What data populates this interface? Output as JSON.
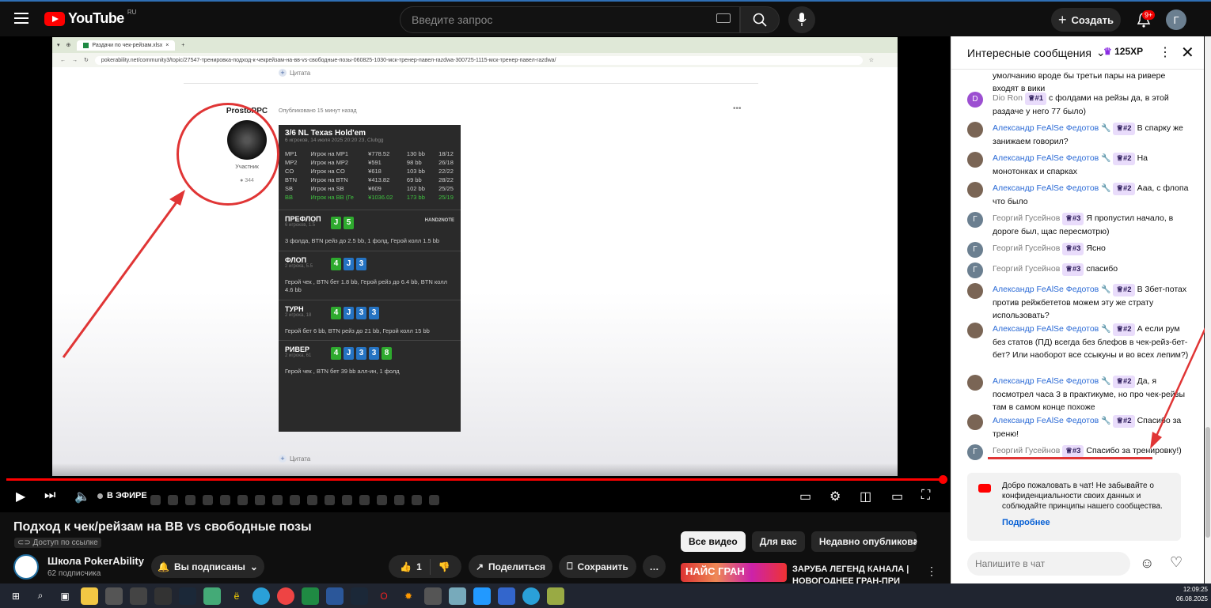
{
  "header": {
    "logo_text": "YouTube",
    "logo_region": "RU",
    "search_placeholder": "Введите запрос",
    "create_label": "Создать",
    "notif_count": "9+",
    "avatar_letter": "Г"
  },
  "video": {
    "browser_tab": "Раздачи по чек-рейзам.xlsx",
    "browser_url": "pokerability.net/community3/topic/27547-тренировка-подход-к-чекрейзам-на-вв-vs-свободные-позы-060825-1030-мск-тренер-павел-razdwa-300725-1115-мск-тренер-павел-razdwa/",
    "quote_label": "Цитата",
    "post_author": "ProstoPPC",
    "post_rank": "Участник",
    "post_count": "344",
    "post_time": "Опубликовано 15 минут назад",
    "hand": {
      "title": "3/6 NL Texas Hold'em",
      "subtitle": "6 игроков, 14 июля 2025 20:20 23, Clubgg",
      "players": [
        {
          "pos": "MP1",
          "name": "Игрок на MP1",
          "stack": "¥778.52",
          "bb": "130 bb",
          "stat": "18/12",
          "hero": false
        },
        {
          "pos": "MP2",
          "name": "Игрок на MP2",
          "stack": "¥591",
          "bb": "98 bb",
          "stat": "26/18",
          "hero": false
        },
        {
          "pos": "CO",
          "name": "Игрок на CO",
          "stack": "¥618",
          "bb": "103 bb",
          "stat": "22/22",
          "hero": false
        },
        {
          "pos": "BTN",
          "name": "Игрок на BTN",
          "stack": "¥413.82",
          "bb": "69 bb",
          "stat": "28/22",
          "hero": false
        },
        {
          "pos": "SB",
          "name": "Игрок на SB",
          "stack": "¥609",
          "bb": "102 bb",
          "stat": "25/25",
          "hero": false
        },
        {
          "pos": "BB",
          "name": "Игрок на BB (Ге",
          "stack": "¥1036.02",
          "bb": "173 bb",
          "stat": "25/19",
          "hero": true
        }
      ],
      "brand": "HAND2NOTE",
      "preflop": {
        "name": "ПРЕФЛОП",
        "count": "6 игроков, 1.5",
        "cards": [
          "J",
          "5"
        ],
        "action": "3 фолда, BTN рейз до 2.5 bb, 1 фолд, Герой колл 1.5 bb"
      },
      "flop": {
        "name": "ФЛОП",
        "count": "2 игрока, 5.5",
        "cards": [
          "4",
          "J",
          "3"
        ],
        "action": "Герой чек , BTN бет 1.8 bb, Герой рейз до 6.4 bb, BTN колл 4.6 bb"
      },
      "turn": {
        "name": "ТУРН",
        "count": "2 игрока, 18",
        "cards": [
          "4",
          "J",
          "3",
          "3"
        ],
        "action": "Герой бет 6 bb, BTN рейз до 21 bb, Герой колл 15 bb"
      },
      "river": {
        "name": "РИВЕР",
        "count": "2 игрока, 61",
        "cards": [
          "4",
          "J",
          "3",
          "3",
          "8"
        ],
        "action": "Герой чек , BTN бет 39 bb алл-ин, 1 фолд"
      }
    },
    "live_label": "В ЭФИРЕ",
    "progress": 1.0
  },
  "info": {
    "title": "Подход к чек/рейзам на BB vs свободные позы",
    "access": "Доступ по ссылке",
    "channel": "Школа PokerAbility",
    "subs": "62 подписчика",
    "subscribed": "Вы подписаны",
    "likes": "1",
    "share": "Поделиться",
    "save": "Сохранить"
  },
  "recs": {
    "chips": [
      "Все видео",
      "Для вас",
      "Недавно опубликованн"
    ],
    "thumb_text": "НАЙС ГРАН",
    "first_title": "ЗАРУБА ЛЕГЕНД КАНАЛА | НОВОГОДНЕЕ ГРАН-ПРИ"
  },
  "chat": {
    "header": "Интересные сообщения",
    "xp": "125XP",
    "messages": [
      {
        "author": "",
        "badge": "",
        "text": "умолчанию вроде бы третьи пары на ривере входят в вики",
        "avatar": "",
        "color": "#fff"
      },
      {
        "author": "Dio Ron",
        "badge": "#1",
        "text": "с фолдами на рейзы да, в этой раздаче у него 77 было)",
        "avatar": "D",
        "color": "#9c4fd1",
        "blue": false
      },
      {
        "author": "Александр FeAlSe Федотов",
        "badge": "#2",
        "text": "В спарку же занижаем говорил?",
        "avatar": "",
        "color": "#7a6555",
        "blue": true
      },
      {
        "author": "Александр FeAlSe Федотов",
        "badge": "#2",
        "text": "На монотонках и спарках",
        "avatar": "",
        "color": "#7a6555",
        "blue": true
      },
      {
        "author": "Александр FeAlSe Федотов",
        "badge": "#2",
        "text": "Ааа, с флопа что было",
        "avatar": "",
        "color": "#7a6555",
        "blue": true
      },
      {
        "author": "Георгий Гусейнов",
        "badge": "#3",
        "text": "Я пропустил начало, в дороге был, щас пересмотрю)",
        "avatar": "Г",
        "color": "#6b7f90",
        "blue": false
      },
      {
        "author": "Георгий Гусейнов",
        "badge": "#3",
        "text": "Ясно",
        "avatar": "Г",
        "color": "#6b7f90",
        "blue": false
      },
      {
        "author": "Георгий Гусейнов",
        "badge": "#3",
        "text": "спасибо",
        "avatar": "Г",
        "color": "#6b7f90",
        "blue": false
      },
      {
        "author": "Александр FeAlSe Федотов",
        "badge": "#2",
        "text": "В 3бет-потах против рейжбететов можем эту же страту использовать?",
        "avatar": "",
        "color": "#7a6555",
        "blue": true
      },
      {
        "author": "Александр FeAlSe Федотов",
        "badge": "#2",
        "text": "А если рум без статов (ПД) всегда без блефов в чек-рейз-бет-бет? Или наоборот все ссыкуны и во всех лепим?)",
        "avatar": "",
        "color": "#7a6555",
        "blue": true
      },
      {
        "author": "Александр FeAlSe Федотов",
        "badge": "#2",
        "text": "Да, я посмотрел часа 3 в практикуме, но про чек-рейзы там в самом конце похоже",
        "avatar": "",
        "color": "#7a6555",
        "blue": true
      },
      {
        "author": "Александр FeAlSe Федотов",
        "badge": "#2",
        "text": "Спасибо за треню!",
        "avatar": "",
        "color": "#7a6555",
        "blue": true
      },
      {
        "author": "Георгий Гусейнов",
        "badge": "#3",
        "text": "Спасибо за тренировку!)",
        "avatar": "Г",
        "color": "#6b7f90",
        "blue": false
      }
    ],
    "welcome": "Добро пожаловать в чат! Не забывайте о конфиденциальности своих данных и соблюдайте принципы нашего сообщества.",
    "welcome_more": "Подробнее",
    "input_placeholder": "Напишите в чат"
  },
  "taskbar": {
    "time": "12:09:25",
    "date": "06.08.2025"
  }
}
